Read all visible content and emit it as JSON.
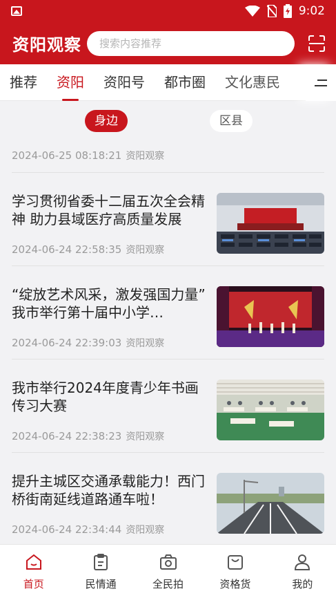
{
  "status_bar": {
    "time": "9:02"
  },
  "header": {
    "logo": "资阳观察",
    "search_placeholder": "搜索内容推荐"
  },
  "tabs": [
    {
      "label": "推荐",
      "active": false
    },
    {
      "label": "资阳",
      "active": true
    },
    {
      "label": "资阳号",
      "active": false
    },
    {
      "label": "都市圈",
      "active": false
    },
    {
      "label": "文化惠民",
      "active": false
    }
  ],
  "filter": {
    "left": "身边",
    "right": "区县"
  },
  "first_meta": {
    "date": "2024-06-25  08:18:21",
    "source": "资阳观察"
  },
  "articles": [
    {
      "title": "学习贯彻省委十二届五次全会精神 助力县域医疗高质量发展",
      "date": "2024-06-24  22:58:35",
      "source": "资阳观察"
    },
    {
      "title": "“绽放艺术风采，激发强国力量” 我市举行第十届中小学…",
      "date": "2024-06-24  22:39:03",
      "source": "资阳观察"
    },
    {
      "title": "我市举行2024年度青少年书画传习大赛",
      "date": "2024-06-24  22:38:23",
      "source": "资阳观察"
    },
    {
      "title": "提升主城区交通承载能力！西门桥街南延线道路通车啦！",
      "date": "2024-06-24  22:34:44",
      "source": "资阳观察"
    }
  ],
  "bottom_nav": [
    {
      "label": "首页",
      "icon": "home-icon",
      "active": true
    },
    {
      "label": "民情通",
      "icon": "clipboard-icon",
      "active": false
    },
    {
      "label": "全民拍",
      "icon": "camera-icon",
      "active": false
    },
    {
      "label": "资格货",
      "icon": "bag-icon",
      "active": false
    },
    {
      "label": "我的",
      "icon": "user-icon",
      "active": false
    }
  ],
  "colors": {
    "brand": "#c8161d"
  }
}
